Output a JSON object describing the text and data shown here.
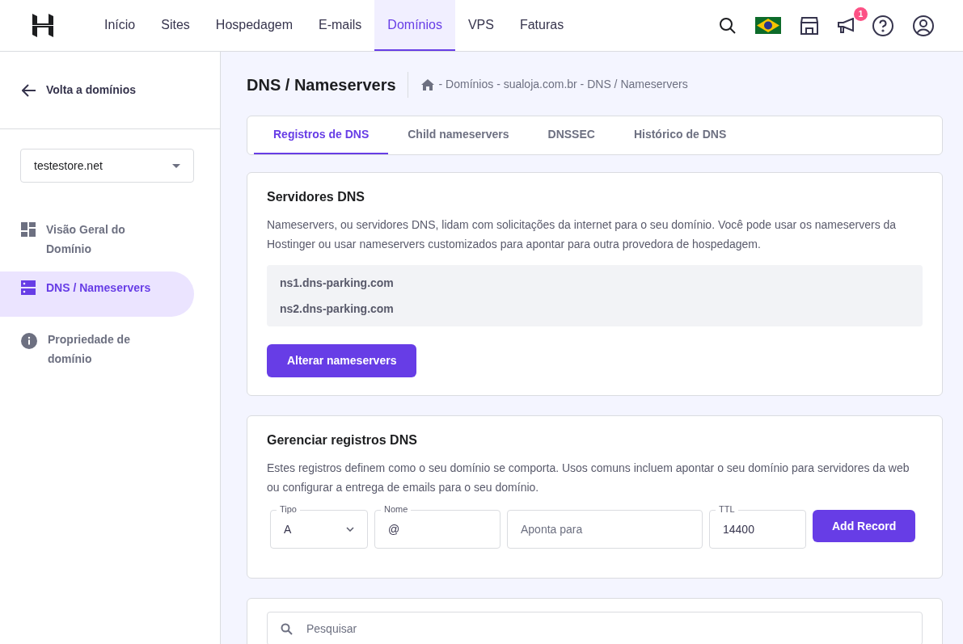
{
  "nav": {
    "items": [
      {
        "label": "Início",
        "selected": false
      },
      {
        "label": "Sites",
        "selected": false
      },
      {
        "label": "Hospedagem",
        "selected": false
      },
      {
        "label": "E-mails",
        "selected": false
      },
      {
        "label": "Domínios",
        "selected": true
      },
      {
        "label": "VPS",
        "selected": false
      },
      {
        "label": "Faturas",
        "selected": false
      }
    ],
    "notification_count": "1"
  },
  "sidebar": {
    "back_link": "Volta a domínios",
    "domain_select": {
      "value": "testestore.net"
    },
    "items": [
      {
        "label": "Visão Geral do Domínio",
        "selected": false
      },
      {
        "label": "DNS / Nameservers",
        "selected": true
      },
      {
        "label": "Propriedade de domínio",
        "selected": false
      }
    ]
  },
  "page": {
    "title": "DNS / Nameservers",
    "breadcrumb": "- Domínios - sualoja.com.br - DNS / Nameservers"
  },
  "tabs": [
    {
      "label": "Registros de DNS",
      "selected": true
    },
    {
      "label": "Child nameservers",
      "selected": false
    },
    {
      "label": "DNSSEC",
      "selected": false
    },
    {
      "label": "Histórico de DNS",
      "selected": false
    }
  ],
  "dns_servers": {
    "title": "Servidores DNS",
    "description": "Nameservers, ou servidores DNS, lidam com solicitações da internet para o seu domínio. Você pode usar os nameservers da Hostinger ou usar nameservers customizados para apontar para outra provedora de hospedagem.",
    "nameservers": [
      "ns1.dns-parking.com",
      "ns2.dns-parking.com"
    ],
    "button": "Alterar nameservers"
  },
  "manage_records": {
    "title": "Gerenciar registros DNS",
    "description": "Estes registros definem como o seu domínio se comporta. Usos comuns incluem apontar o seu domínio para servidores da web ou configurar a entrega de emails para o seu domínio.",
    "fields": [
      {
        "kind": "select",
        "label": "Tipo",
        "value": "A"
      },
      {
        "kind": "input",
        "label": "Nome",
        "value": "@"
      },
      {
        "kind": "input",
        "placeholder": "Aponta para"
      },
      {
        "kind": "input",
        "label": "TTL",
        "value": "14400"
      }
    ],
    "button": "Add Record"
  },
  "search": {
    "placeholder": "Pesquisar"
  }
}
